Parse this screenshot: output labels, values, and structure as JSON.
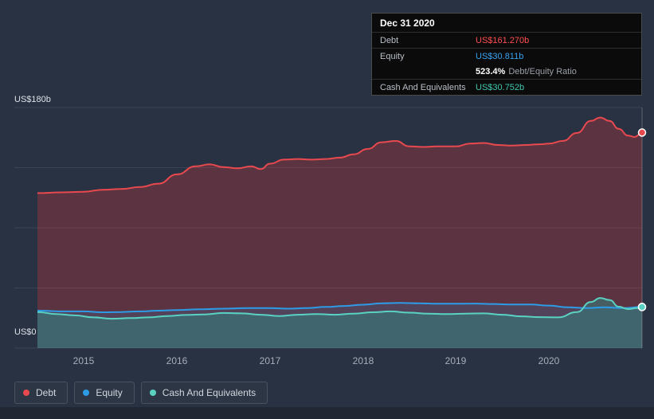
{
  "colors": {
    "background": "#293242",
    "debt": "#e8494e",
    "equity": "#2e9be6",
    "cash": "#5ad2c3",
    "gridline": "#97a3bd"
  },
  "tooltip": {
    "date": "Dec 31 2020",
    "debt_label": "Debt",
    "debt_value": "US$161.270b",
    "equity_label": "Equity",
    "equity_value": "US$30.811b",
    "ratio_value": "523.4%",
    "ratio_text": "Debt/Equity Ratio",
    "cash_label": "Cash And Equivalents",
    "cash_value": "US$30.752b"
  },
  "axis": {
    "y_top": "US$180b",
    "y_bottom": "US$0",
    "x_ticks": [
      "2015",
      "2016",
      "2017",
      "2018",
      "2019",
      "2020"
    ]
  },
  "legend": {
    "items": [
      {
        "label": "Debt",
        "color": "#e8494e"
      },
      {
        "label": "Equity",
        "color": "#2e9be6"
      },
      {
        "label": "Cash And Equivalents",
        "color": "#5ad2c3"
      }
    ]
  },
  "chart_data": {
    "type": "area",
    "title": "Debt to Equity History",
    "x_range": [
      2014.5,
      2021.0
    ],
    "ylim": [
      0,
      180
    ],
    "y_unit": "US$ billions",
    "gridline_values": [
      0,
      45,
      90,
      135,
      180
    ],
    "x_tick_years": [
      2015,
      2016,
      2017,
      2018,
      2019,
      2020
    ],
    "series": [
      {
        "id": "debt",
        "name": "Debt",
        "color": "#e8494e",
        "fill": "rgba(226,58,66,0.28)",
        "end_value": 161.27,
        "points": [
          [
            2014.5,
            116
          ],
          [
            2014.75,
            116.5
          ],
          [
            2015.0,
            117
          ],
          [
            2015.2,
            118.5
          ],
          [
            2015.4,
            119
          ],
          [
            2015.6,
            120.5
          ],
          [
            2015.8,
            123
          ],
          [
            2016.0,
            130
          ],
          [
            2016.2,
            136
          ],
          [
            2016.35,
            137.5
          ],
          [
            2016.5,
            135.5
          ],
          [
            2016.65,
            134.5
          ],
          [
            2016.8,
            136
          ],
          [
            2016.9,
            134
          ],
          [
            2017.0,
            138
          ],
          [
            2017.15,
            141
          ],
          [
            2017.3,
            141.5
          ],
          [
            2017.45,
            141
          ],
          [
            2017.6,
            141.5
          ],
          [
            2017.75,
            142.5
          ],
          [
            2017.9,
            145
          ],
          [
            2018.05,
            149
          ],
          [
            2018.2,
            154
          ],
          [
            2018.35,
            155
          ],
          [
            2018.5,
            151
          ],
          [
            2018.65,
            150.5
          ],
          [
            2018.8,
            151
          ],
          [
            2019.0,
            151
          ],
          [
            2019.15,
            153
          ],
          [
            2019.3,
            153.5
          ],
          [
            2019.45,
            152
          ],
          [
            2019.6,
            151.5
          ],
          [
            2019.75,
            152
          ],
          [
            2019.9,
            152.5
          ],
          [
            2020.0,
            153
          ],
          [
            2020.15,
            155
          ],
          [
            2020.3,
            161
          ],
          [
            2020.45,
            170
          ],
          [
            2020.55,
            172.5
          ],
          [
            2020.65,
            170
          ],
          [
            2020.75,
            164
          ],
          [
            2020.85,
            159
          ],
          [
            2020.92,
            158
          ],
          [
            2021.0,
            161.27
          ]
        ]
      },
      {
        "id": "equity",
        "name": "Equity",
        "color": "#2e9be6",
        "fill": "rgba(34,146,223,0.16)",
        "end_value": 30.811,
        "points": [
          [
            2014.5,
            28
          ],
          [
            2014.8,
            27.5
          ],
          [
            2015.0,
            27.5
          ],
          [
            2015.2,
            26.8
          ],
          [
            2015.4,
            27
          ],
          [
            2015.6,
            27.5
          ],
          [
            2015.8,
            28
          ],
          [
            2016.0,
            28.5
          ],
          [
            2016.25,
            29
          ],
          [
            2016.5,
            29.5
          ],
          [
            2016.75,
            30
          ],
          [
            2017.0,
            30
          ],
          [
            2017.2,
            29.5
          ],
          [
            2017.4,
            30
          ],
          [
            2017.6,
            30.8
          ],
          [
            2017.8,
            31.5
          ],
          [
            2018.0,
            32.5
          ],
          [
            2018.2,
            33.5
          ],
          [
            2018.4,
            33.8
          ],
          [
            2018.6,
            33.5
          ],
          [
            2018.8,
            33.2
          ],
          [
            2019.0,
            33.2
          ],
          [
            2019.2,
            33.3
          ],
          [
            2019.4,
            33
          ],
          [
            2019.6,
            32.6
          ],
          [
            2019.8,
            32.6
          ],
          [
            2020.0,
            31.8
          ],
          [
            2020.2,
            30.5
          ],
          [
            2020.4,
            30
          ],
          [
            2020.6,
            30.5
          ],
          [
            2020.8,
            30
          ],
          [
            2021.0,
            30.811
          ]
        ]
      },
      {
        "id": "cash",
        "name": "Cash And Equivalents",
        "color": "#5ad2c3",
        "fill": "rgba(47,136,132,0.50)",
        "end_value": 30.752,
        "points": [
          [
            2014.5,
            27
          ],
          [
            2014.7,
            25.5
          ],
          [
            2014.9,
            24.5
          ],
          [
            2015.1,
            23
          ],
          [
            2015.3,
            22
          ],
          [
            2015.5,
            22.5
          ],
          [
            2015.7,
            23
          ],
          [
            2015.9,
            24
          ],
          [
            2016.1,
            24.8
          ],
          [
            2016.3,
            25.2
          ],
          [
            2016.5,
            26.3
          ],
          [
            2016.7,
            26
          ],
          [
            2016.9,
            25
          ],
          [
            2017.1,
            24
          ],
          [
            2017.3,
            25
          ],
          [
            2017.5,
            25.5
          ],
          [
            2017.7,
            25
          ],
          [
            2017.9,
            25.8
          ],
          [
            2018.1,
            26.8
          ],
          [
            2018.3,
            27.5
          ],
          [
            2018.5,
            26.5
          ],
          [
            2018.7,
            25.8
          ],
          [
            2018.9,
            25.5
          ],
          [
            2019.1,
            25.8
          ],
          [
            2019.3,
            26
          ],
          [
            2019.5,
            25
          ],
          [
            2019.7,
            23.8
          ],
          [
            2019.9,
            23.2
          ],
          [
            2020.1,
            23
          ],
          [
            2020.3,
            27
          ],
          [
            2020.45,
            34.5
          ],
          [
            2020.55,
            37.5
          ],
          [
            2020.65,
            36
          ],
          [
            2020.75,
            31
          ],
          [
            2020.85,
            29.2
          ],
          [
            2020.95,
            30
          ],
          [
            2021.0,
            30.752
          ]
        ]
      }
    ]
  }
}
